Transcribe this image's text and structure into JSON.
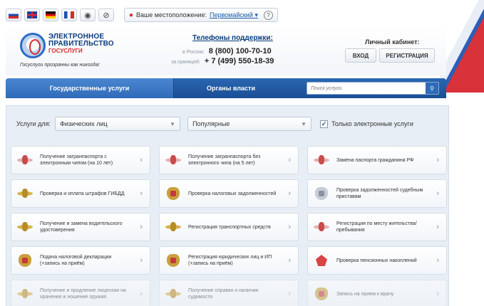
{
  "topbar": {
    "langs": [
      {
        "name": "ru-flag-icon",
        "cls": "flag-ru"
      },
      {
        "name": "uk-flag-icon",
        "cls": "flag-uk"
      },
      {
        "name": "de-flag-icon",
        "cls": "flag-de"
      },
      {
        "name": "fr-flag-icon",
        "cls": "flag-fr"
      }
    ],
    "location_label": "Ваше местоположение:",
    "location_value": "Первомайский ▾",
    "help": "?"
  },
  "header": {
    "logo_line1": "ЭЛЕКТРОННОЕ",
    "logo_line2": "ПРАВИТЕЛЬСТВО",
    "logo_line3": "ГОСУСЛУГИ",
    "tagline": "Госуслуги прозрачны как никогда!",
    "support_title": "Телефоны поддержки:",
    "support_ru_label": "в России:",
    "support_ru_number": "8 (800) 100-70-10",
    "support_abroad_label": "за границей:",
    "support_abroad_number": "+ 7 (499) 550-18-39",
    "cabinet_label": "Личный кабинет:",
    "login_label": "ВХОД",
    "register_label": "РЕГИСТРАЦИЯ"
  },
  "nav": {
    "tab_services": "Государственные услуги",
    "tab_authorities": "Органы власти",
    "search_placeholder": "Поиск услуги"
  },
  "filters": {
    "label": "Услуги для:",
    "audience_value": "Физических лиц",
    "sort_value": "Популярные",
    "electronic_only_label": "Только электронные услуги",
    "electronic_only_checked": true
  },
  "services": [
    {
      "text": "Получение загранпаспорта с электронным чипом (на 10 лет)",
      "icon": "red",
      "name": "passport-chip-icon"
    },
    {
      "text": "Получение загранпаспорта без электронного чипа (на 5 лет)",
      "icon": "red",
      "name": "passport-nochip-icon"
    },
    {
      "text": "Замена паспорта гражданина РФ",
      "icon": "red",
      "name": "passport-replace-icon"
    },
    {
      "text": "Проверка и оплата штрафов ГИБДД",
      "icon": "gold",
      "name": "traffic-police-icon"
    },
    {
      "text": "Проверка налоговых задолженностей",
      "icon": "eagle",
      "name": "tax-eagle-icon"
    },
    {
      "text": "Проверка задолженностей судебным приставам",
      "icon": "eagle-grey",
      "name": "bailiff-eagle-icon"
    },
    {
      "text": "Получение и замена водительского удостоверения",
      "icon": "gold",
      "name": "driver-license-icon"
    },
    {
      "text": "Регистрация транспортных средств",
      "icon": "gold",
      "name": "vehicle-registration-icon"
    },
    {
      "text": "Регистрация по месту жительства/пребывания",
      "icon": "red",
      "name": "residence-registration-icon"
    },
    {
      "text": "Подача налоговой декларации (+запись на приём)",
      "icon": "eagle",
      "name": "tax-declaration-icon"
    },
    {
      "text": "Регистрация юридических лиц и ИП (+запись на приём)",
      "icon": "eagle",
      "name": "legal-entity-icon"
    },
    {
      "text": "Проверка пенсионных накоплений",
      "icon": "pension",
      "name": "pension-icon"
    },
    {
      "text": "Получение и продление лицензии на хранение и ношение оружия",
      "icon": "gold",
      "name": "weapon-license-icon",
      "faded": true
    },
    {
      "text": "Получение справки о наличии судимости",
      "icon": "gold",
      "name": "criminal-record-icon",
      "faded": true
    },
    {
      "text": "Запись на прием к врачу",
      "icon": "eagle",
      "name": "doctor-appointment-icon",
      "faded": true
    }
  ]
}
